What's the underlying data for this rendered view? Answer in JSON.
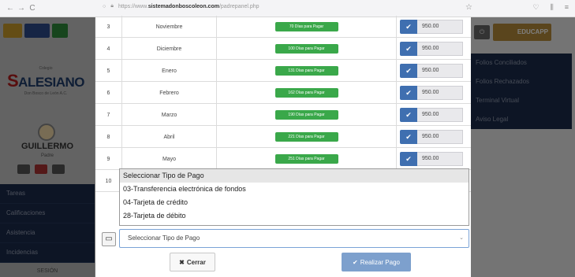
{
  "browser": {
    "back": "←",
    "forward": "→",
    "reload": "C",
    "url_prefix": "https://www.",
    "url_host": "sistemadonboscoleon.com",
    "url_path": "/padrepanel.php"
  },
  "background": {
    "logo_small": "Colegio",
    "logo_big": "ALESIANO",
    "logo_sub": "Don Bosco de León A.C.",
    "user_name": "GUILLERMO",
    "user_role": "Padre",
    "left_menu": [
      "Tareas",
      "Calificaciones",
      "Asistencia",
      "Incidencias",
      "SESIÓN"
    ],
    "right_logo": "EDUCAPP",
    "right_menu": [
      "Folios Conciliados",
      "Folios Rechazados",
      "Terminal Virtual",
      "Aviso Legal"
    ]
  },
  "payments": [
    {
      "num": "3",
      "month": "Noviembre",
      "days": "70 Días para Pagar",
      "amount": "950.00"
    },
    {
      "num": "4",
      "month": "Diciembre",
      "days": "100 Días para Pagar",
      "amount": "950.00"
    },
    {
      "num": "5",
      "month": "Enero",
      "days": "131 Días para Pagar",
      "amount": "950.00"
    },
    {
      "num": "6",
      "month": "Febrero",
      "days": "162 Días para Pagar",
      "amount": "950.00"
    },
    {
      "num": "7",
      "month": "Marzo",
      "days": "190 Días para Pagar",
      "amount": "950.00"
    },
    {
      "num": "8",
      "month": "Abril",
      "days": "221 Días para Pagar",
      "amount": "950.00"
    },
    {
      "num": "9",
      "month": "Mayo",
      "days": "251 Días para Pagar",
      "amount": "950.00"
    },
    {
      "num": "10",
      "month": "",
      "days": "",
      "amount": ""
    }
  ],
  "dropdown": {
    "options": [
      "Seleccionar Tipo de Pago",
      "03-Transferencia electrónica de fondos",
      "04-Tarjeta de crédito",
      "28-Tarjeta de débito"
    ]
  },
  "select": {
    "value": "Seleccionar Tipo de Pago"
  },
  "buttons": {
    "close": "Cerrar",
    "pay": "Realizar Pago"
  },
  "colors": {
    "accent": "#3f6fb0",
    "success": "#3aa84a",
    "navy": "#1a2a4a"
  }
}
